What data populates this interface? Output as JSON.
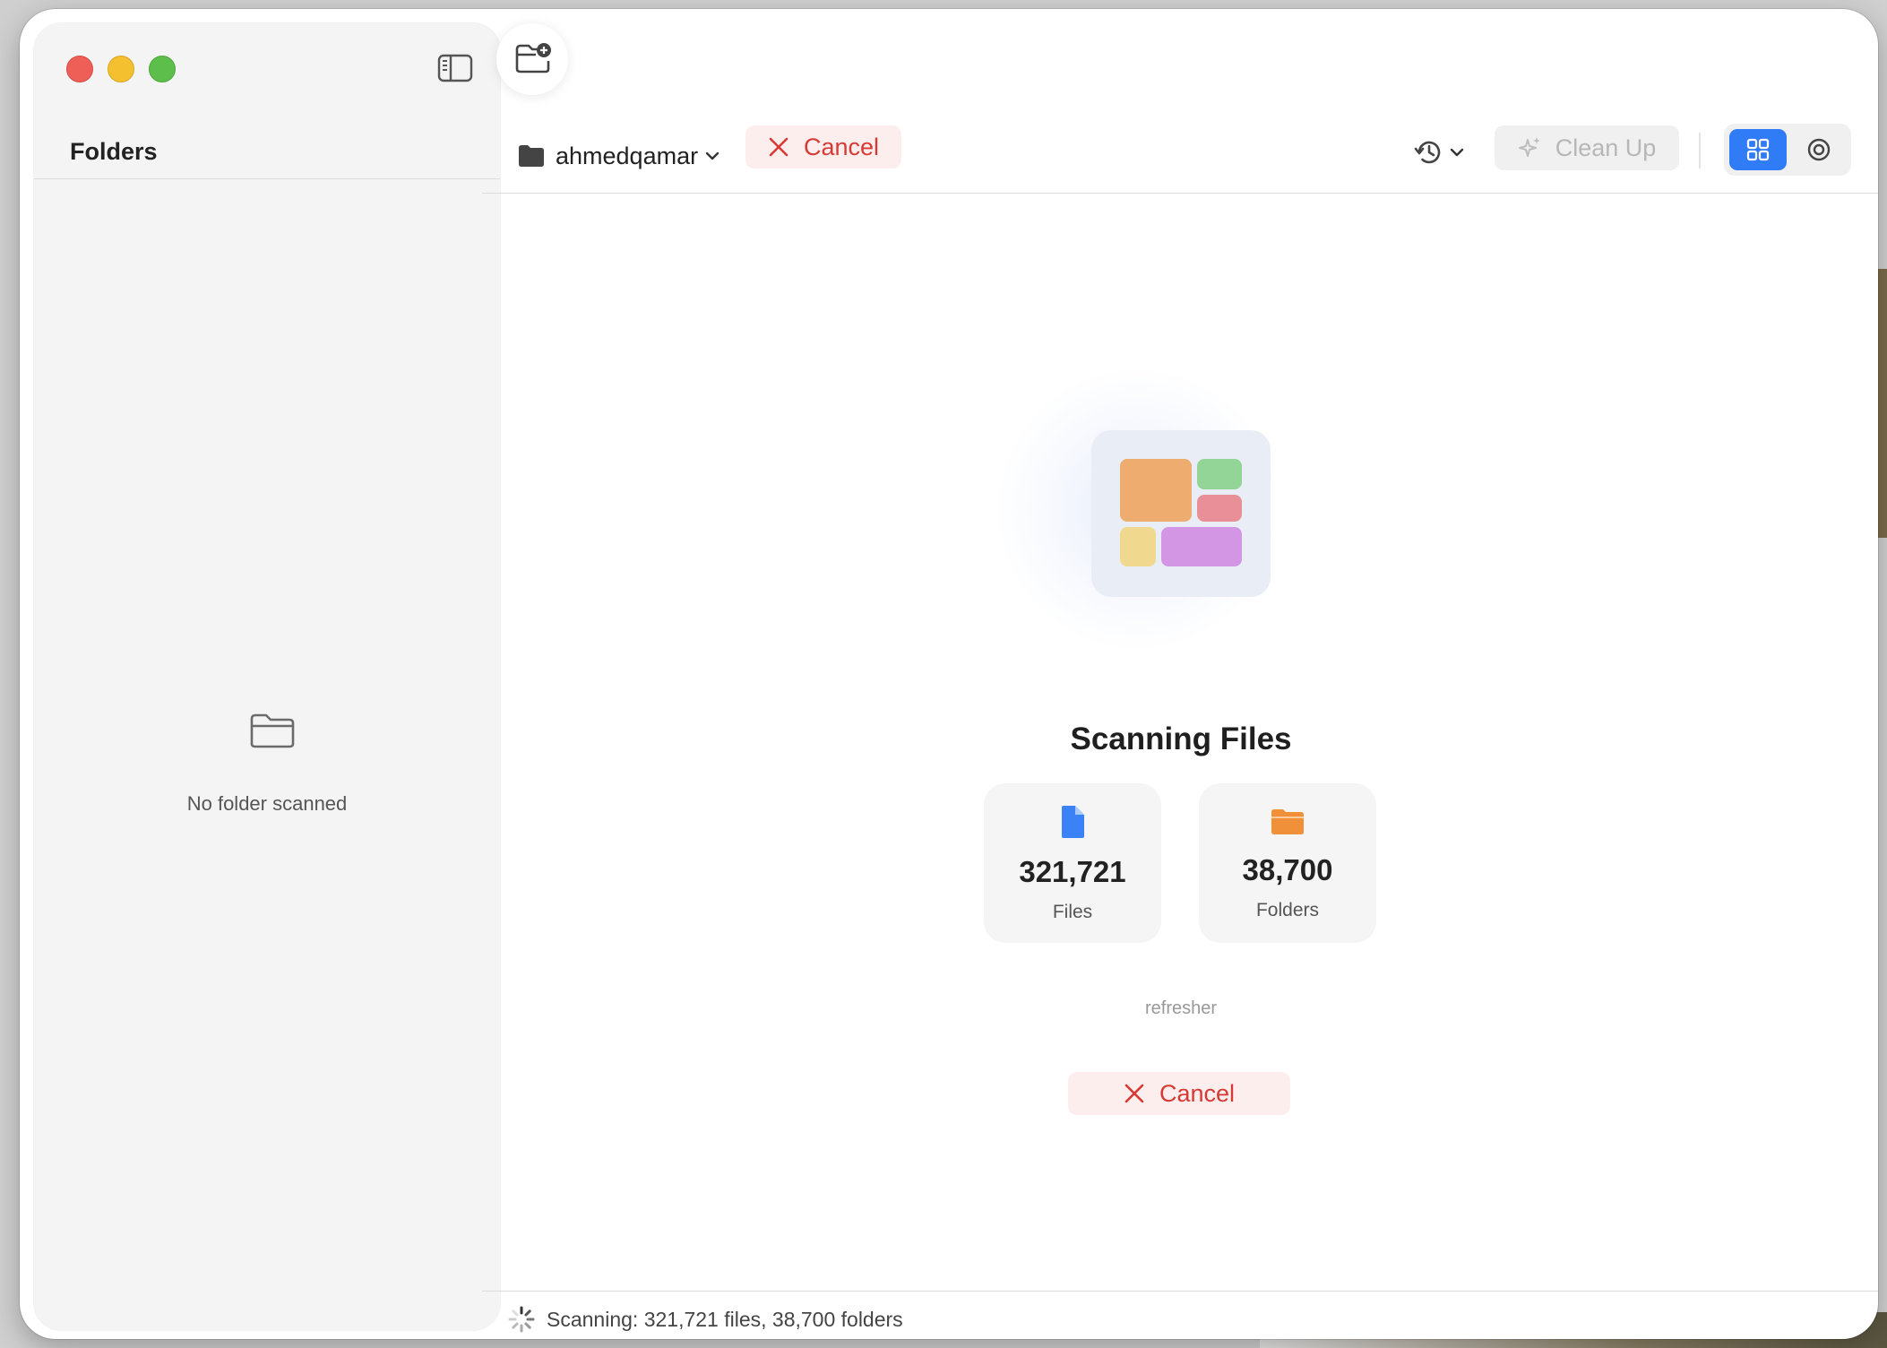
{
  "window": {
    "sidebar_toggle_icon": "sidebar-left-icon",
    "new_folder_icon": "folder-badge-plus-icon"
  },
  "sidebar": {
    "title": "Folders",
    "empty_icon": "folder-icon",
    "empty_text": "No folder scanned"
  },
  "toolbar": {
    "folder_name": "ahmedqamar",
    "cancel_label": "Cancel",
    "history_icon": "clock-arrow-icon",
    "clean_up_label": "Clean Up",
    "clean_up_icon": "sparkles-icon",
    "view_modes": [
      "grid-icon",
      "ring-icon"
    ],
    "selected_view": "grid"
  },
  "main": {
    "title": "Scanning Files",
    "files_count": "321,721",
    "files_label": "Files",
    "folders_count": "38,700",
    "folders_label": "Folders",
    "current_path": "refresher",
    "cancel_label": "Cancel"
  },
  "status": {
    "text": "Scanning: 321,721 files, 38,700 folders"
  },
  "colors": {
    "accent": "#2f7cf6",
    "danger": "#d73a34",
    "file_icon": "#3b82f6",
    "folder_icon": "#f0913a",
    "tile_orange": "#eeac6e",
    "tile_green": "#92d596",
    "tile_pink": "#e88f97",
    "tile_yellow": "#f1d88f",
    "tile_purple": "#d396e5"
  }
}
